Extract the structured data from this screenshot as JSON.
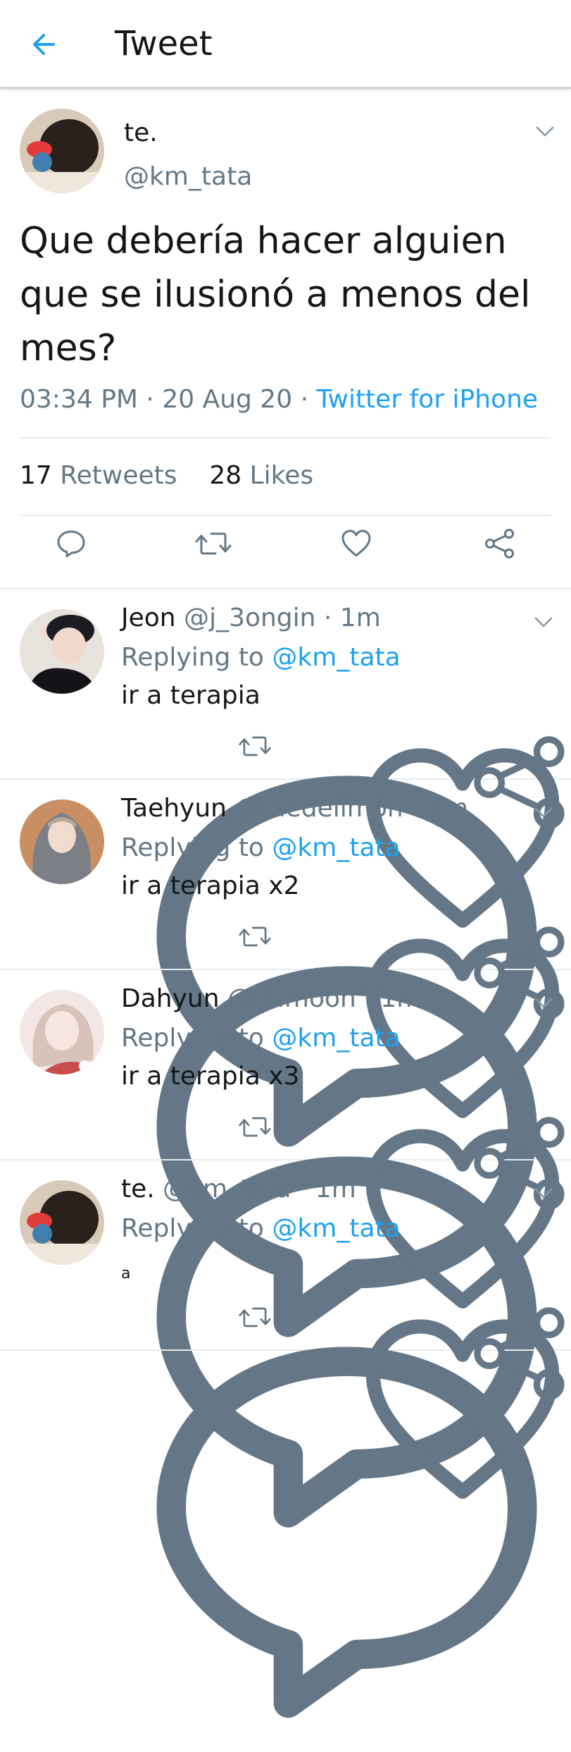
{
  "header": {
    "title": "Tweet",
    "back_icon": "arrow-left-icon"
  },
  "main_tweet": {
    "display_name": "te.",
    "handle": "@km_tata",
    "text": "Que debería hacer alguien que se ilusionó a menos del mes?",
    "time": "03:34 PM",
    "sep1": " · ",
    "date": "20 Aug 20",
    "sep2": " · ",
    "source": "Twitter for iPhone",
    "retweets_count": "17",
    "retweets_label": "Retweets",
    "likes_count": "28",
    "likes_label": "Likes"
  },
  "replies": [
    {
      "display_name": "Jeon",
      "handle": "@j_3ongin",
      "sep": " · ",
      "time": "1m",
      "replying_label": "Replying to ",
      "replying_to": "@km_tata",
      "text": "ir a terapia"
    },
    {
      "display_name": "Taehyun",
      "handle": "@taedelimon",
      "sep": " · ",
      "time": "1m",
      "replying_label": "Replying to ",
      "replying_to": "@km_tata",
      "text": "ir a terapia x2"
    },
    {
      "display_name": "Dahyun",
      "handle": "@damoon",
      "sep": " · ",
      "time": "1m",
      "replying_label": "Replying to ",
      "replying_to": "@km_tata",
      "text": "ir a terapia x3"
    },
    {
      "display_name": "te.",
      "handle": "@km_tata",
      "sep": " · ",
      "time": "1m",
      "replying_label": "Replying to ",
      "replying_to": "@km_tata",
      "text": "a"
    }
  ],
  "icons": [
    "reply-icon",
    "retweet-icon",
    "like-icon",
    "share-icon",
    "chevron-down-icon"
  ],
  "colors": {
    "accent": "#1da1f2",
    "muted": "#657786",
    "text": "#14171a",
    "divider": "#e6ecf0"
  }
}
